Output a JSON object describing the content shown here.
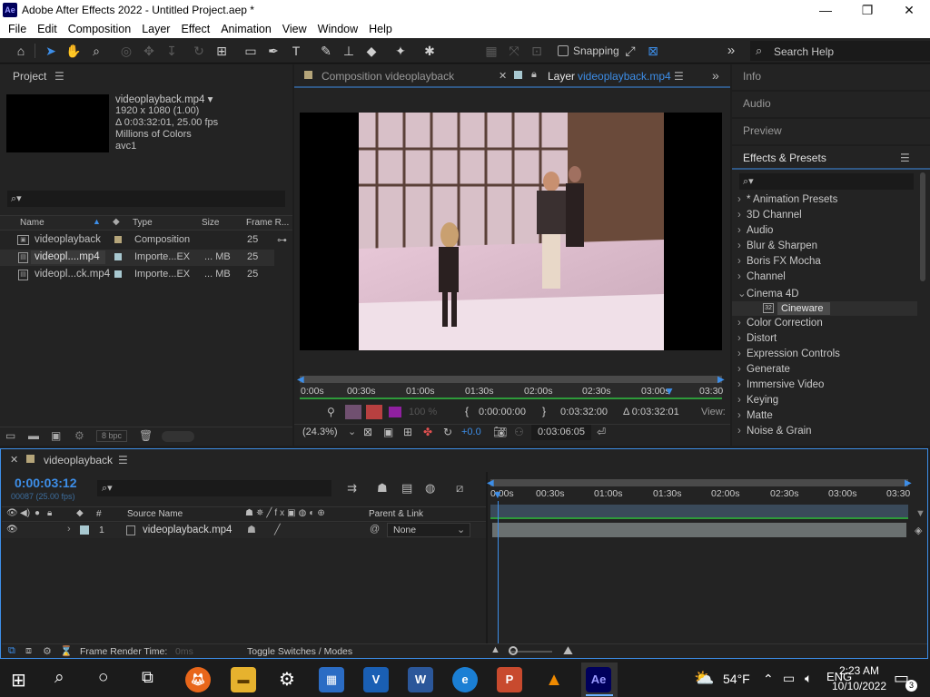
{
  "title": {
    "text": "Adobe After Effects 2022 - Untitled Project.aep *",
    "logo": "Ae"
  },
  "menu": [
    "File",
    "Edit",
    "Composition",
    "Layer",
    "Effect",
    "Animation",
    "View",
    "Window",
    "Help"
  ],
  "toolbar": {
    "snapping": "Snapping",
    "search_placeholder": "Search Help",
    "expand": "»"
  },
  "project": {
    "title": "Project",
    "file_name": "videoplayback.mp4 ▾",
    "info_lines": [
      "1920 x 1080 (1.00)",
      "Δ 0:03:32:01, 25.00 fps",
      "Millions of Colors",
      "avc1"
    ],
    "search_icon": "⌕▾",
    "columns": {
      "name": "Name",
      "type": "Type",
      "size": "Size",
      "frame_rate": "Frame R..."
    },
    "items": [
      {
        "name": "videoplayback",
        "type": "Composition",
        "size": "",
        "fps": "25"
      },
      {
        "name": "videopl....mp4",
        "type": "Importe...EX",
        "size": "... MB",
        "fps": "25"
      },
      {
        "name": "videopl...ck.mp4",
        "type": "Importe...EX",
        "size": "... MB",
        "fps": "25"
      }
    ],
    "bpc": "8 bpc"
  },
  "viewer": {
    "tab_comp": "Composition videoplayback",
    "tab_layer_prefix": "Layer",
    "tab_layer_name": "videoplayback.mp4",
    "ruler": [
      "0:00s",
      "00:30s",
      "01:00s",
      "01:30s",
      "02:00s",
      "02:30s",
      "03:00s",
      "03:30"
    ],
    "time_in": "0:00:00:00",
    "time_out": "0:03:32:00",
    "duration": "Δ 0:03:32:01",
    "view_label": "View:",
    "zoom": "(24.3%)",
    "exposure": "+0.0",
    "current_time": "0:03:06:05",
    "res_label": "100 %"
  },
  "right_panels": {
    "info": "Info",
    "audio": "Audio",
    "preview": "Preview",
    "effects_title": "Effects & Presets",
    "search_icon": "⌕▾",
    "categories": [
      {
        "label": "* Animation Presets",
        "chev": "›"
      },
      {
        "label": "3D Channel",
        "chev": "›"
      },
      {
        "label": "Audio",
        "chev": "›"
      },
      {
        "label": "Blur & Sharpen",
        "chev": "›"
      },
      {
        "label": "Boris FX Mocha",
        "chev": "›"
      },
      {
        "label": "Channel",
        "chev": "›"
      },
      {
        "label": "Cinema 4D",
        "chev": "⌄"
      },
      {
        "label": "Color Correction",
        "chev": "›"
      },
      {
        "label": "Distort",
        "chev": "›"
      },
      {
        "label": "Expression Controls",
        "chev": "›"
      },
      {
        "label": "Generate",
        "chev": "›"
      },
      {
        "label": "Immersive Video",
        "chev": "›"
      },
      {
        "label": "Keying",
        "chev": "›"
      },
      {
        "label": "Matte",
        "chev": "›"
      },
      {
        "label": "Noise & Grain",
        "chev": "›"
      }
    ],
    "sub_item": "Cineware",
    "sub_badge": "32"
  },
  "timeline": {
    "tab": "videoplayback",
    "time": "0:00:03:12",
    "frames": "00087 (25.00 fps)",
    "columns": {
      "num": "#",
      "source": "Source Name",
      "parent": "Parent & Link"
    },
    "layer": {
      "num": "1",
      "name": "videoplayback.mp4",
      "parent": "None"
    },
    "ruler": [
      "0:00s",
      "00:30s",
      "01:00s",
      "01:30s",
      "02:00s",
      "02:30s",
      "03:00s",
      "03:30"
    ],
    "footer_render": "Frame Render Time:",
    "footer_render_value": "0ms",
    "footer_toggle": "Toggle Switches / Modes"
  },
  "taskbar": {
    "weather": "54°F",
    "time": "2:23 AM",
    "date": "10/10/2022",
    "notif": "3",
    "apps": [
      "Ae",
      "P",
      "W",
      "V"
    ]
  }
}
